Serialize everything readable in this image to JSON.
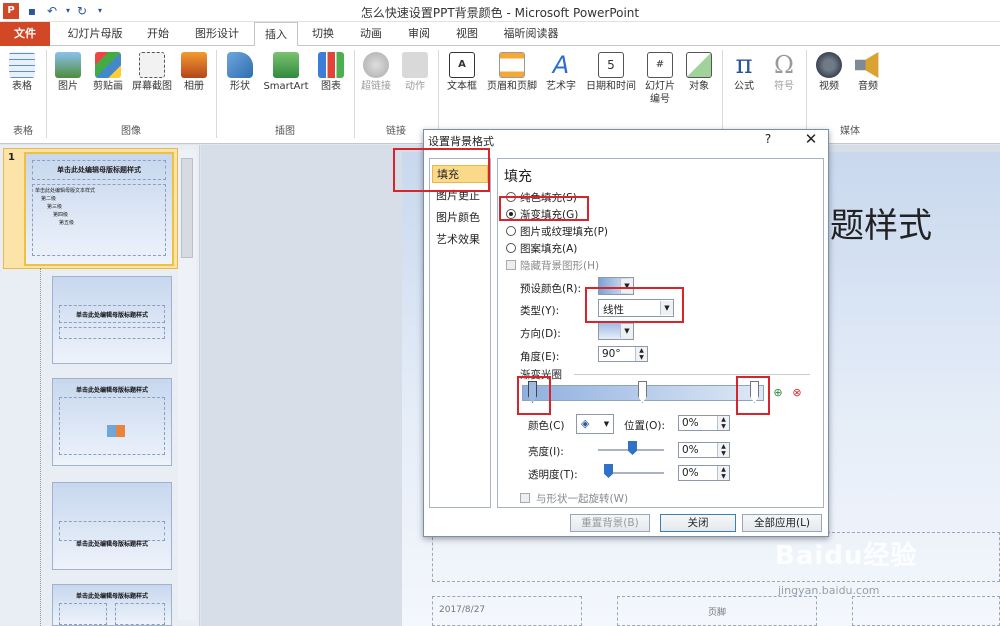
{
  "titlebar": {
    "title": "怎么快速设置PPT背景颜色 - Microsoft PowerPoint"
  },
  "tabs": [
    "文件",
    "幻灯片母版",
    "开始",
    "图形设计",
    "插入",
    "切换",
    "动画",
    "审阅",
    "视图",
    "福昕阅读器"
  ],
  "ribbon": {
    "buttons": [
      "表格",
      "图片",
      "剪贴画",
      "屏幕截图",
      "相册",
      "形状",
      "SmartArt",
      "图表",
      "超链接",
      "动作",
      "文本框",
      "页眉和页脚",
      "艺术字",
      "日期和时间",
      "幻灯片\n编号",
      "对象",
      "公式",
      "符号",
      "视频",
      "音频"
    ],
    "groups": [
      "表格",
      "图像",
      "插图",
      "链接",
      "媒体"
    ]
  },
  "slides": {
    "slide1_number": "1",
    "title_text": "单击此处编辑母版标题样式",
    "body_text": "单击此处编辑母版文本样式",
    "levels": [
      "第二级",
      "第三级",
      "第四级",
      "第五级"
    ]
  },
  "main": {
    "title_fragment": "题样式",
    "footer_date": "2017/8/27",
    "footer_text": "页脚"
  },
  "dialog": {
    "title": "设置背景格式",
    "help": "?",
    "close": "✕",
    "categories": [
      "填充",
      "图片更正",
      "图片颜色",
      "艺术效果"
    ],
    "section_title": "填充",
    "options": [
      "纯色填充(S)",
      "渐变填充(G)",
      "图片或纹理填充(P)",
      "图案填充(A)"
    ],
    "selected_option": "渐变填充(G)",
    "hide_bg": "隐藏背景图形(H)",
    "preset_label": "预设颜色(R):",
    "type_label": "类型(Y):",
    "type_value": "线性",
    "direction_label": "方向(D):",
    "angle_label": "角度(E):",
    "angle_value": "90°",
    "stops_label": "渐变光圈",
    "color_label": "颜色(C)",
    "position_label": "位置(O):",
    "position_value": "0%",
    "brightness_label": "亮度(I):",
    "brightness_value": "0%",
    "transparency_label": "透明度(T):",
    "transparency_value": "0%",
    "rotate_label": "与形状一起旋转(W)",
    "reset_button": "重置背景(B)",
    "close_button": "关闭",
    "apply_all_button": "全部应用(L)"
  },
  "watermark": {
    "logo": "Baidu经验",
    "url": "jingyan.baidu.com"
  },
  "colors": {
    "file_tab": "#d24726",
    "highlight": "#d6262c",
    "selection": "#fbd98a",
    "accent": "#2b579a"
  }
}
